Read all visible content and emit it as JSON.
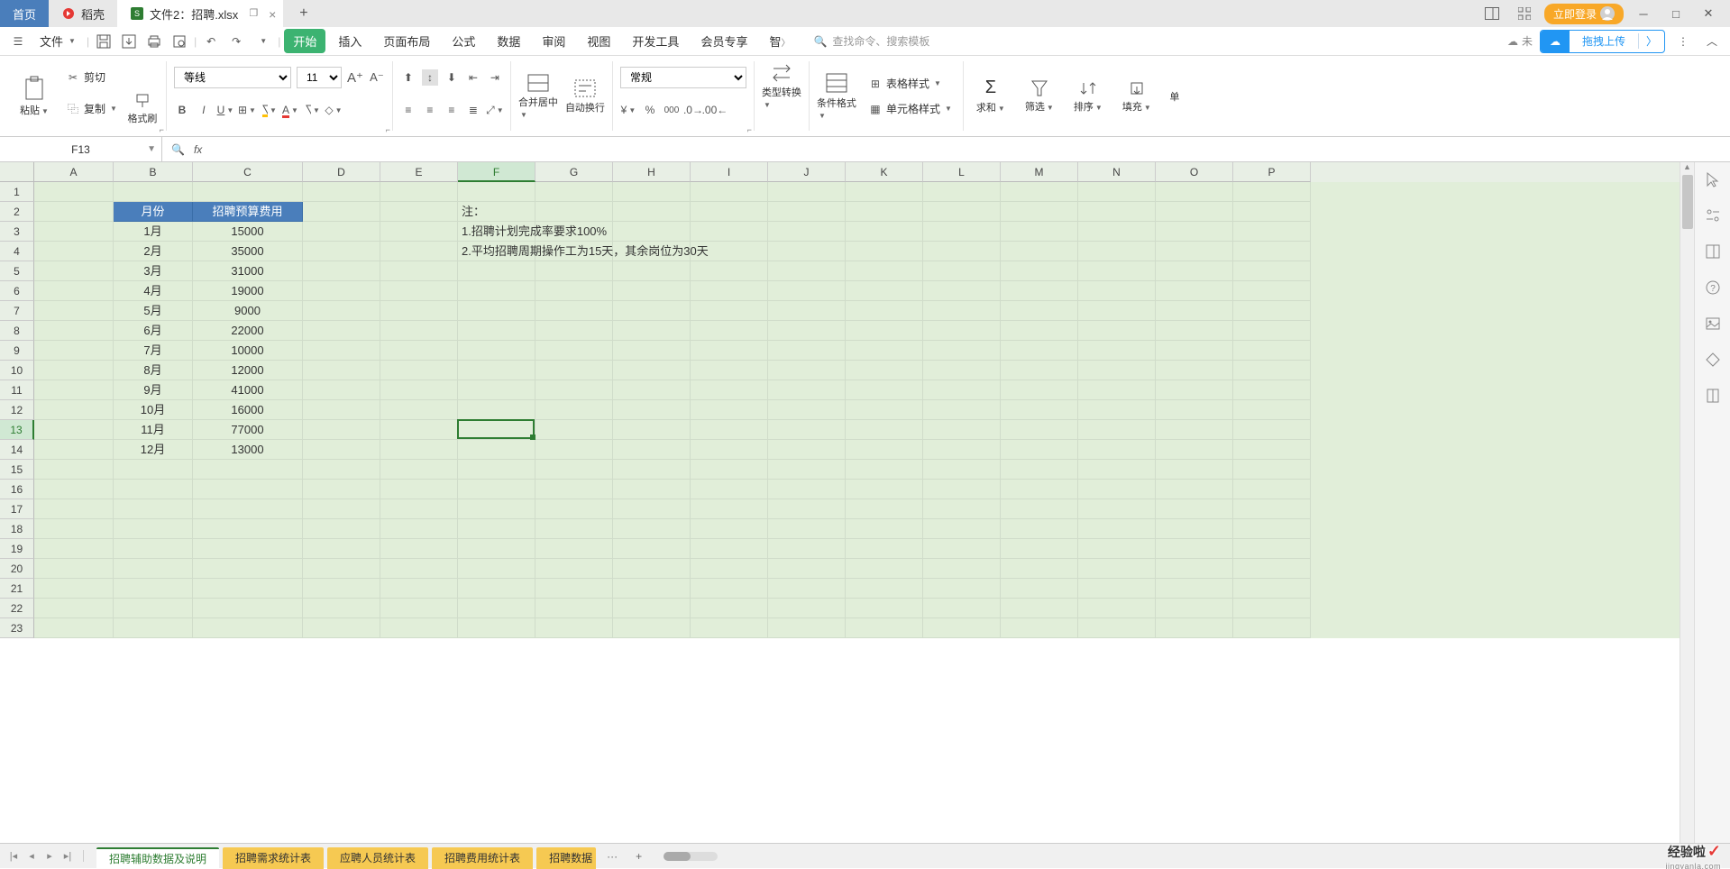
{
  "titlebar": {
    "home": "首页",
    "ds": "稻壳",
    "file_prefix": "文件2：",
    "file_name": "招聘.xlsx",
    "login": "立即登录"
  },
  "menubar": {
    "file": "文件",
    "tabs": [
      "开始",
      "插入",
      "页面布局",
      "公式",
      "数据",
      "审阅",
      "视图",
      "开发工具",
      "会员专享",
      "智"
    ],
    "search_placeholder": "查找命令、搜索模板",
    "unsync": "未",
    "upload": "拖拽上传"
  },
  "ribbon": {
    "paste": "粘贴",
    "cut": "剪切",
    "copy": "复制",
    "format_painter": "格式刷",
    "font_name": "等线",
    "font_size": "11",
    "merge_center": "合并居中",
    "auto_wrap": "自动换行",
    "number_format": "常规",
    "type_convert": "类型转换",
    "cond_format": "条件格式",
    "table_style": "表格样式",
    "cell_style": "单元格样式",
    "sum": "求和",
    "filter": "筛选",
    "sort": "排序",
    "fill": "填充",
    "single": "单"
  },
  "name_box": "F13",
  "columns": [
    "A",
    "B",
    "C",
    "D",
    "E",
    "F",
    "G",
    "H",
    "I",
    "J",
    "K",
    "L",
    "M",
    "N",
    "O",
    "P"
  ],
  "rows_count": 23,
  "selected_col": "F",
  "selected_row": 13,
  "headers": {
    "month": "月份",
    "budget": "招聘预算费用"
  },
  "table": [
    {
      "month": "1月",
      "budget": "15000"
    },
    {
      "month": "2月",
      "budget": "35000"
    },
    {
      "month": "3月",
      "budget": "31000"
    },
    {
      "month": "4月",
      "budget": "19000"
    },
    {
      "month": "5月",
      "budget": "9000"
    },
    {
      "month": "6月",
      "budget": "22000"
    },
    {
      "month": "7月",
      "budget": "10000"
    },
    {
      "month": "8月",
      "budget": "12000"
    },
    {
      "month": "9月",
      "budget": "41000"
    },
    {
      "month": "10月",
      "budget": "16000"
    },
    {
      "month": "11月",
      "budget": "77000"
    },
    {
      "month": "12月",
      "budget": "13000"
    }
  ],
  "notes": {
    "title": "注：",
    "line1": "1.招聘计划完成率要求100%",
    "line2": "2.平均招聘周期操作工为15天，其余岗位为30天"
  },
  "sheets": {
    "active": "招聘辅助数据及说明",
    "others": [
      "招聘需求统计表",
      "应聘人员统计表",
      "招聘费用统计表",
      "招聘数据"
    ]
  },
  "watermark": {
    "main": "经验啦",
    "sub": "jingyanla.com"
  }
}
